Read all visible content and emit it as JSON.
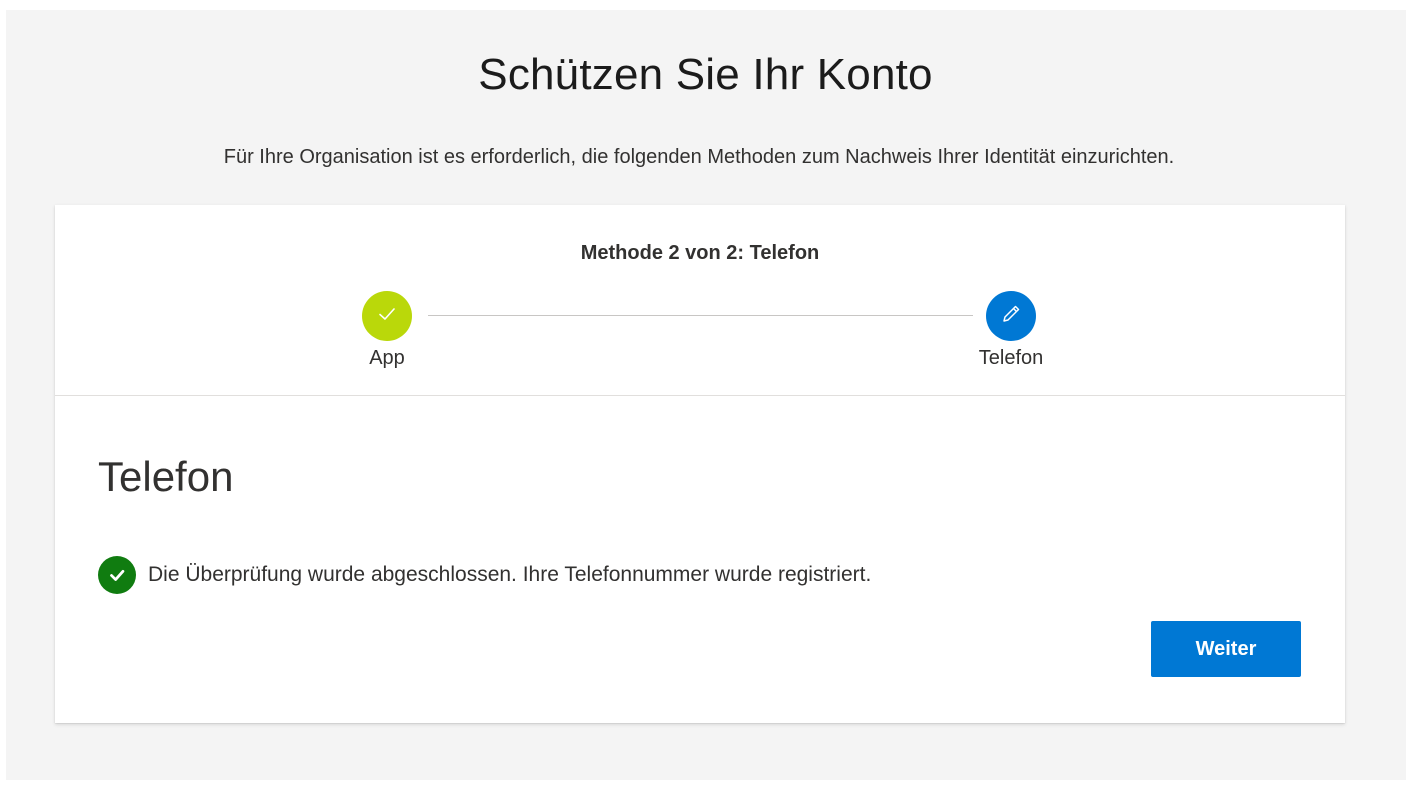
{
  "header": {
    "title": "Schützen Sie Ihr Konto",
    "subtitle": "Für Ihre Organisation ist es erforderlich, die folgenden Methoden zum Nachweis Ihrer Identität einzurichten."
  },
  "stepper": {
    "caption": "Methode 2 von 2: Telefon",
    "steps": [
      {
        "label": "App",
        "state": "completed",
        "icon": "checkmark-icon",
        "color": "#bad80a"
      },
      {
        "label": "Telefon",
        "state": "active",
        "icon": "pencil-icon",
        "color": "#0078d4"
      }
    ]
  },
  "main": {
    "section_title": "Telefon",
    "status": {
      "icon": "success-check-icon",
      "color": "#107c10",
      "text": "Die Überprüfung wurde abgeschlossen. Ihre Telefonnummer wurde registriert."
    },
    "next_button": {
      "label": "Weiter",
      "color": "#0078d4"
    }
  }
}
